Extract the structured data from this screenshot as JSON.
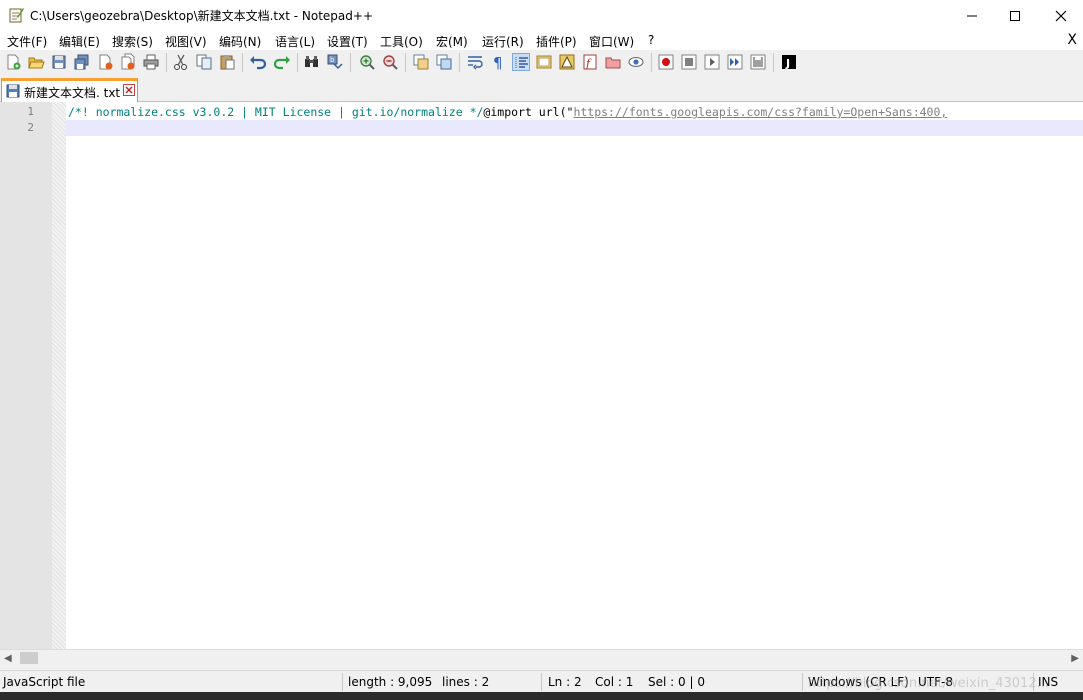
{
  "window": {
    "title": "C:\\Users\\geozebra\\Desktop\\新建文本文档.txt - Notepad++"
  },
  "menu": {
    "items": [
      "文件(F)",
      "编辑(E)",
      "搜索(S)",
      "视图(V)",
      "编码(N)",
      "语言(L)",
      "设置(T)",
      "工具(O)",
      "宏(M)",
      "运行(R)",
      "插件(P)",
      "窗口(W)",
      "?"
    ],
    "close_label": "X"
  },
  "toolbar": {
    "icons": [
      "new-file-icon",
      "open-file-icon",
      "save-icon",
      "save-all-icon",
      "close-icon",
      "close-all-icon",
      "print-icon",
      "cut-icon",
      "copy-icon",
      "paste-icon",
      "undo-icon",
      "redo-icon",
      "find-icon",
      "replace-icon",
      "zoom-in-icon",
      "zoom-out-icon",
      "sync-vertical-icon",
      "sync-horizontal-icon",
      "word-wrap-icon",
      "show-all-chars-icon",
      "indent-guide-icon",
      "language-icon",
      "doc-map-icon",
      "function-list-icon",
      "folder-workspace-icon",
      "monitor-icon",
      "record-macro-icon",
      "stop-macro-icon",
      "play-macro-icon",
      "run-macro-multiple-icon",
      "save-macro-icon",
      "jstool-icon"
    ]
  },
  "tab": {
    "label": "新建文本文档. txt"
  },
  "editor": {
    "line_numbers": [
      "1",
      "2"
    ],
    "line1": {
      "comment": "/*! normalize.css v3.0.2 | MIT License | git.io/normalize */",
      "import": "@import url(\"",
      "url": "https://fonts.googleapis.com/css?family=Open+Sans:400,"
    },
    "line2": ""
  },
  "statusbar": {
    "file_type": "JavaScript file",
    "length": "length : 9,095",
    "lines": "lines : 2",
    "ln": "Ln : 2",
    "col": "Col : 1",
    "sel": "Sel : 0 | 0",
    "eol": "Windows (CR LF)",
    "encoding": "UTF-8",
    "mode": "INS",
    "watermark": "https://blog.csdn.net/weixin_43012..."
  },
  "colors": {
    "comment": "#008080",
    "url": "#808080",
    "current_line": "#e8e8ff",
    "tab_accent": "#f8a030"
  }
}
